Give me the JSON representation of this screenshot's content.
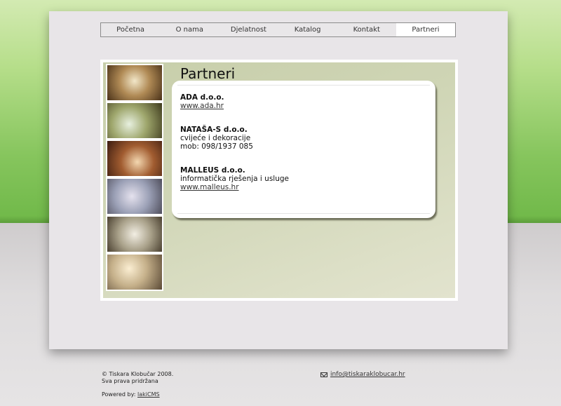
{
  "nav": {
    "items": [
      {
        "label": "Početna"
      },
      {
        "label": "O nama"
      },
      {
        "label": "Djelatnost"
      },
      {
        "label": "Katalog"
      },
      {
        "label": "Kontakt"
      },
      {
        "label": "Partneri"
      }
    ],
    "active": "Partneri"
  },
  "main": {
    "title": "Partneri",
    "partners": [
      {
        "name": "ADA d.o.o.",
        "link": "www.ada.hr"
      },
      {
        "name": "NATAŠA-S d.o.o.",
        "line1": "cvijeće i dekoracije",
        "line2": "mob: 098/1937 085"
      },
      {
        "name": "MALLEUS d.o.o.",
        "line1": "informatička rješenja i usluge",
        "link": "www.malleus.hr"
      }
    ]
  },
  "footer": {
    "copyright": "© Tiskara Klobučar 2008.",
    "rights": "Sva prava pridržana",
    "powered_prefix": "Powered by:",
    "powered_link": "lakiCMS",
    "email": "info@tiskaraklobucar.hr"
  },
  "colors": {
    "green_top": "#86c55d",
    "page_bg": "#e8e5e8",
    "content_bg": "#cfd5b5"
  }
}
